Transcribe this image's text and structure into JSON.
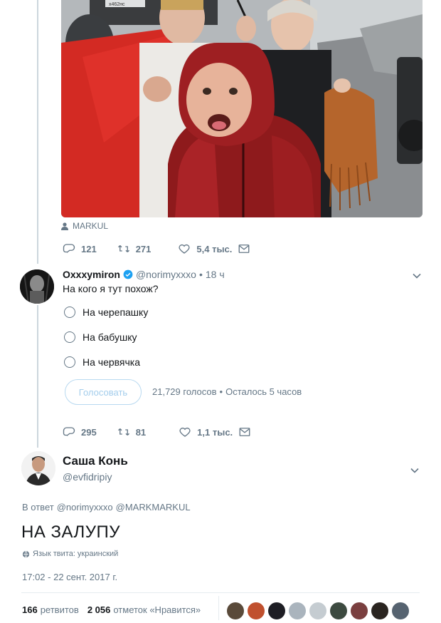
{
  "tweet1": {
    "tagged_user": "MARKUL",
    "replies": "121",
    "retweets": "271",
    "likes": "5,4 тыс.",
    "plate_text": "х462нс"
  },
  "tweet2": {
    "name": "Oxxxymiron",
    "handle": "@norimyxxxo",
    "time": "18 ч",
    "text": "На кого я тут похож?",
    "poll": {
      "options": [
        "На черепашку",
        "На бабушку",
        "На червячка"
      ],
      "vote_label": "Голосовать",
      "votes": "21,729 голосов",
      "remaining": "Осталось 5 часов",
      "dot": "•"
    },
    "replies": "295",
    "retweets": "81",
    "likes": "1,1 тыс."
  },
  "tweet3": {
    "name": "Саша Конь",
    "handle": "@evfidripiy",
    "reply_prefix": "В ответ",
    "reply_to_1": "@norimyxxxo",
    "reply_to_2": "@MARKMARKUL",
    "text": "НА ЗАЛУПУ",
    "lang": "Язык твита: украинский",
    "timestamp": "17:02 - 22 сент. 2017 г.",
    "retweets_count": "166",
    "retweets_label": "ретвитов",
    "likes_count": "2 056",
    "likes_label": "отметок «Нравится»"
  },
  "colors": {
    "accent": "#1da1f2",
    "muted": "#657786",
    "verified": "#1da1f2"
  }
}
